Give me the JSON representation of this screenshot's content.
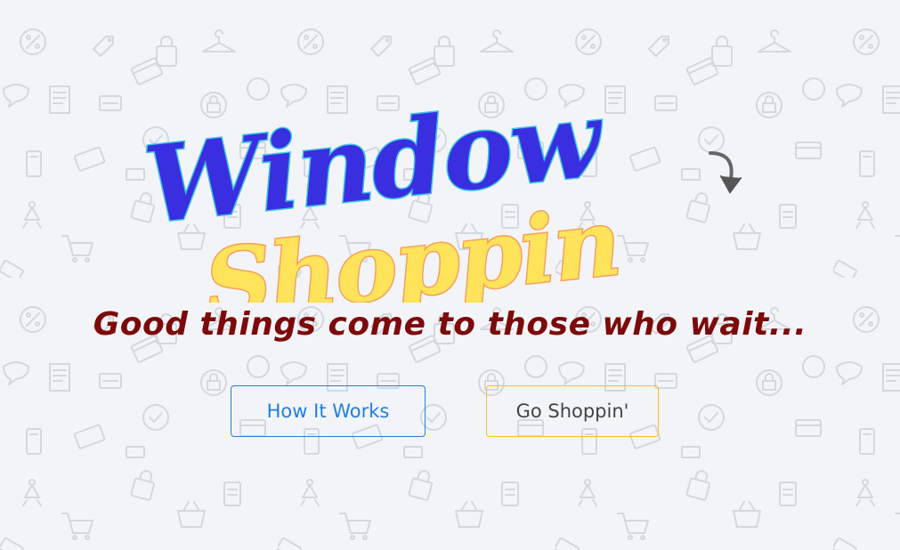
{
  "logo": {
    "line1": "Window",
    "line2": "Shoppin"
  },
  "hero": {
    "tagline": "Good things come to those who wait..."
  },
  "buttons": {
    "how_it_works": "How It Works",
    "go_shoppin": "Go Shoppin'"
  },
  "colors": {
    "background": "#f3f4f8",
    "pattern": "#d4d7de",
    "logo_primary": "#3a2fe0",
    "logo_primary_outline": "#39c3e6",
    "logo_secondary": "#ffe35a",
    "logo_secondary_outline": "#f5a05a",
    "tagline": "#7c0a0a",
    "how_button": "#1f7fe0",
    "go_button_border": "#f3c221",
    "go_button_text": "#444444"
  },
  "icons": [
    "percent-tag-icon",
    "price-tag-icon",
    "shopping-bag-icon",
    "hanger-icon",
    "credit-card-icon",
    "receipt-icon",
    "new-badge-icon",
    "checkmark-circle-icon",
    "sale-tag-icon",
    "shopping-cart-icon",
    "basket-icon",
    "mobile-payment-icon",
    "redo-arrow-icon"
  ]
}
